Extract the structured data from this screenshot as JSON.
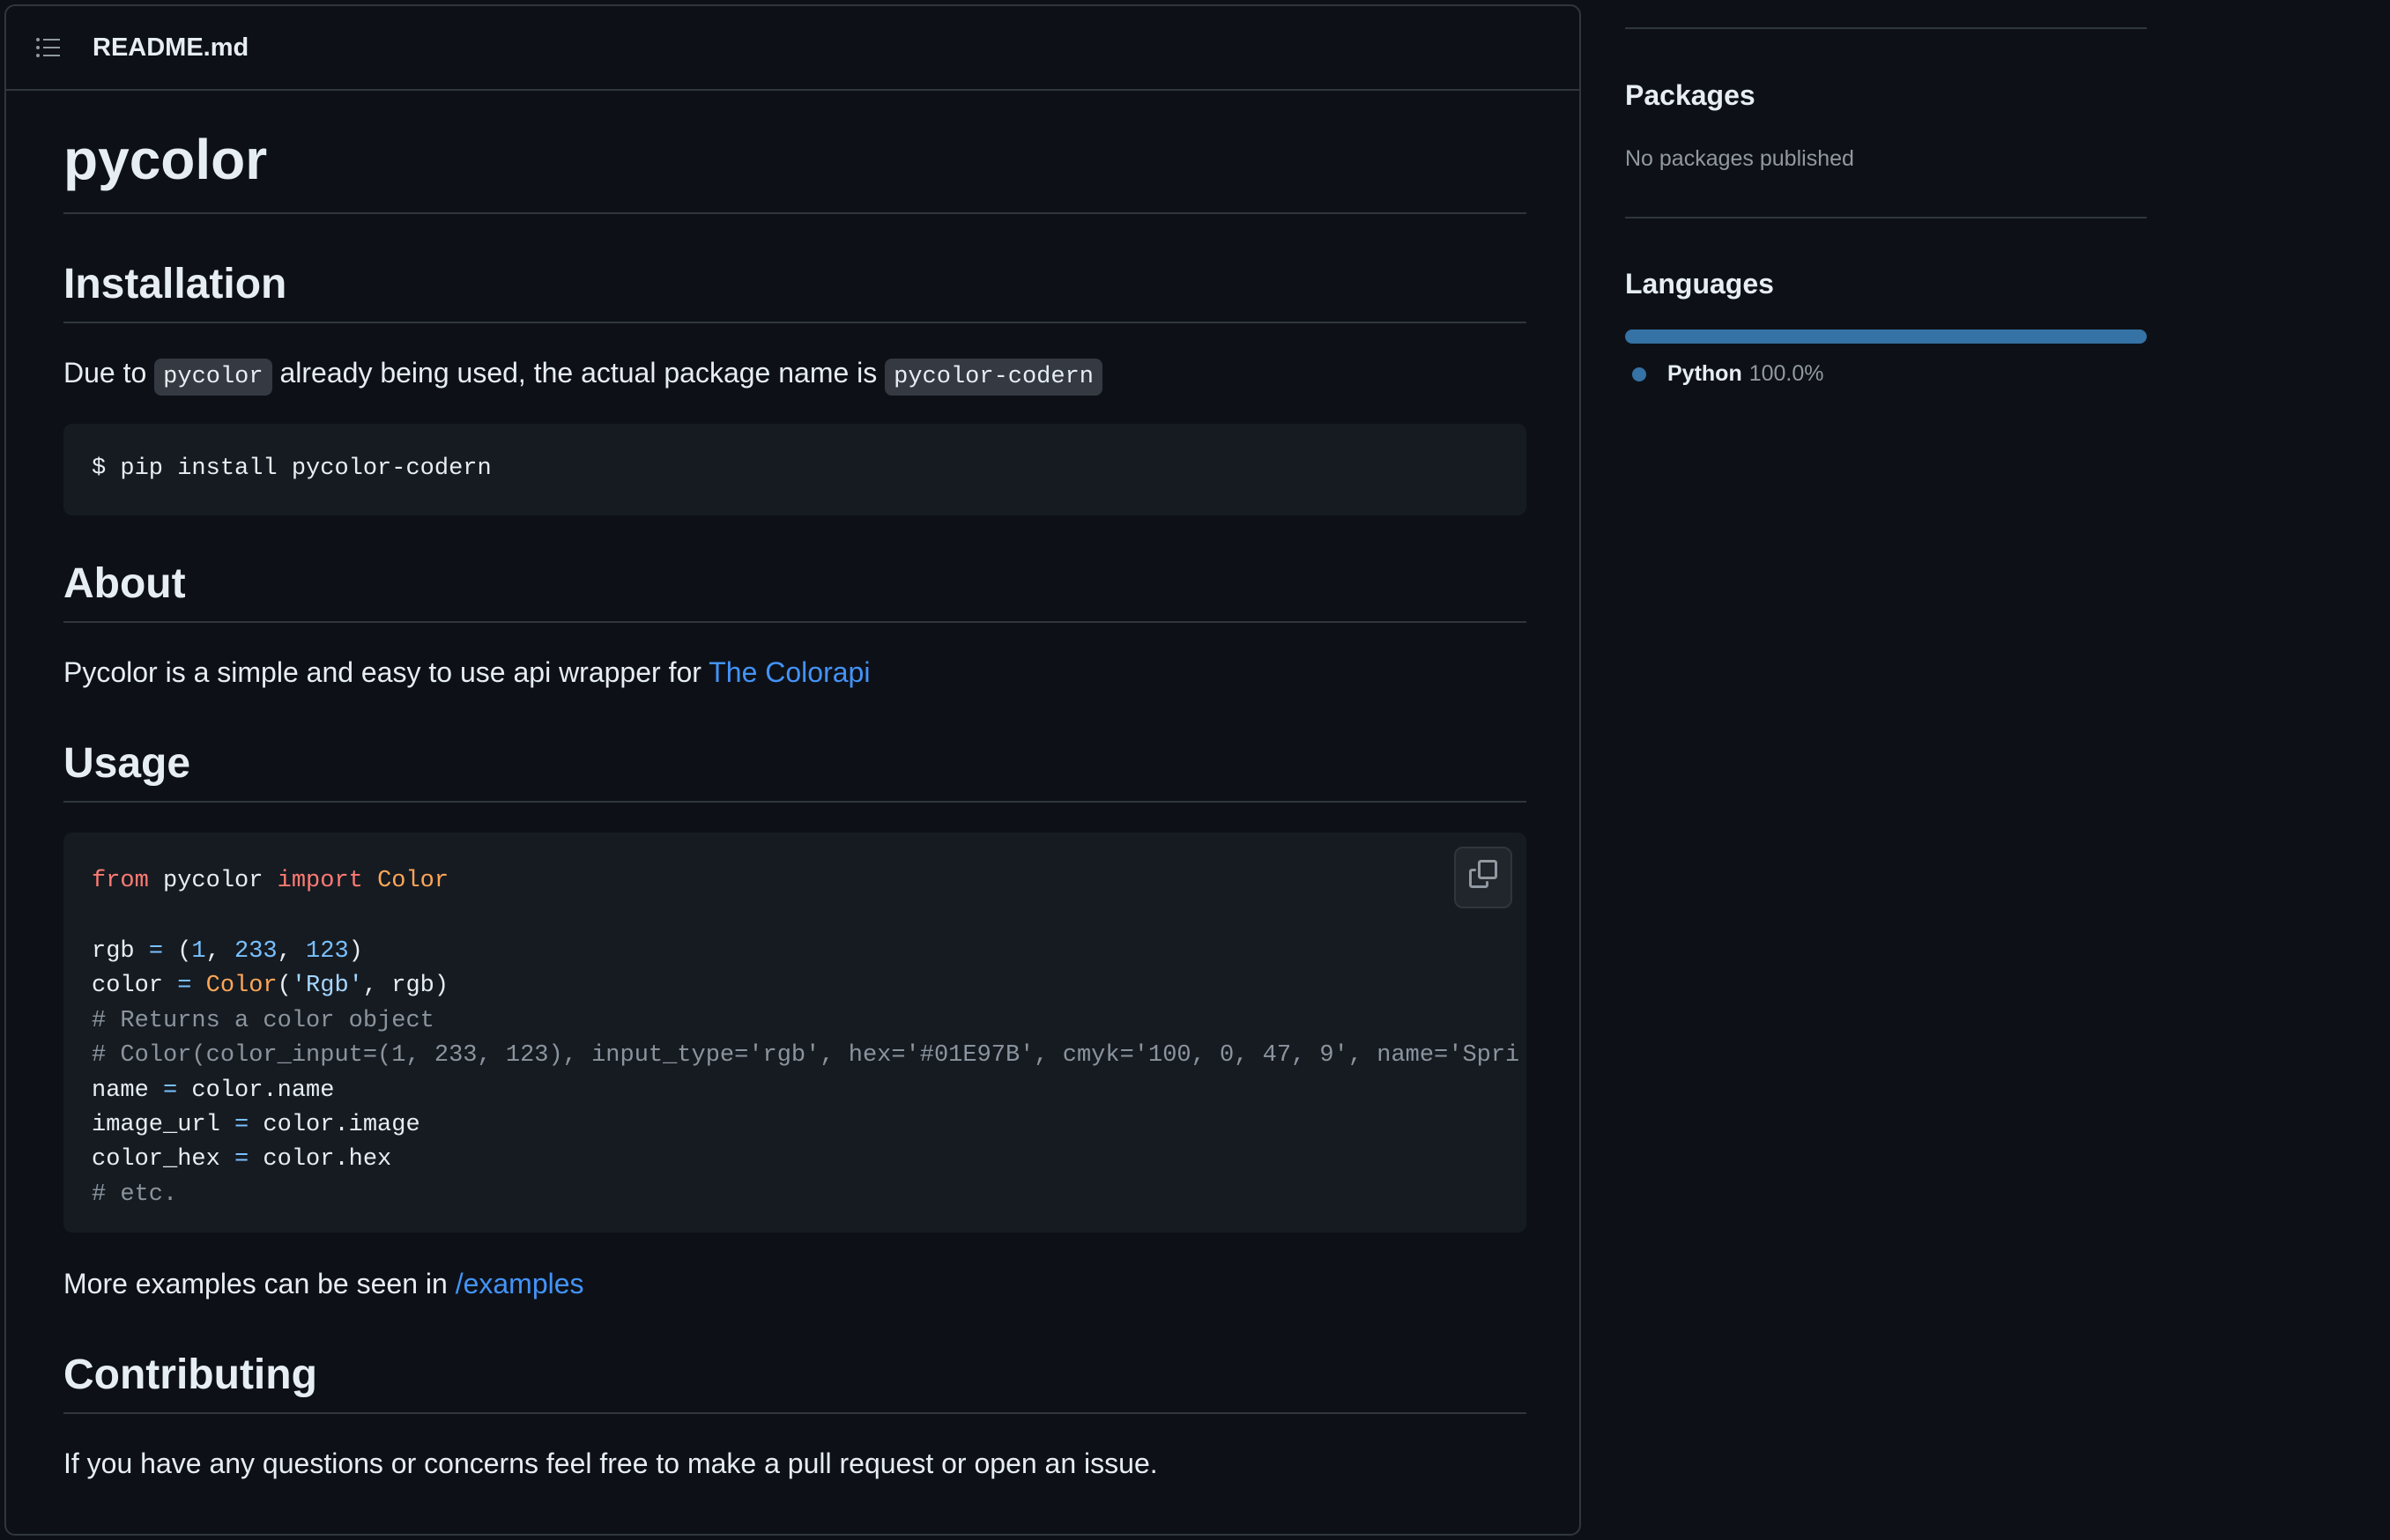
{
  "readme": {
    "filename": "README.md",
    "title": "pycolor",
    "installation": {
      "heading": "Installation",
      "text_before": "Due to ",
      "code1": "pycolor",
      "text_middle": " already being used, the actual package name is ",
      "code2": "pycolor-codern",
      "command": "$ pip install pycolor-codern"
    },
    "about": {
      "heading": "About",
      "text": "Pycolor is a simple and easy to use api wrapper for ",
      "link": "The Colorapi"
    },
    "usage": {
      "heading": "Usage",
      "code": {
        "l1_from": "from",
        "l1_mod": " pycolor ",
        "l1_import": "import",
        "l1_cls": "Color",
        "l3_a": "rgb ",
        "l3_eq": "=",
        "l3_b": " (",
        "l3_n1": "1",
        "l3_c1": ", ",
        "l3_n2": "233",
        "l3_c2": ", ",
        "l3_n3": "123",
        "l3_e": ")",
        "l4_a": "color ",
        "l4_eq": "=",
        "l4_sp": " ",
        "l4_cls": "Color",
        "l4_p": "(",
        "l4_str": "'Rgb'",
        "l4_rest": ", rgb)",
        "l5": "# Returns a color object",
        "l6": "# Color(color_input=(1, 233, 123), input_type='rgb', hex='#01E97B', cmyk='100, 0, 47, 9', name='Spri",
        "l7_a": "name ",
        "l7_eq": "=",
        "l7_b": " color.name",
        "l8_a": "image_url ",
        "l8_eq": "=",
        "l8_b": " color.image",
        "l9_a": "color_hex ",
        "l9_eq": "=",
        "l9_b": " color.hex",
        "l10": "# etc."
      },
      "more_text": "More examples can be seen in ",
      "more_link": "/examples"
    },
    "contributing": {
      "heading": "Contributing",
      "text": "If you have any questions or concerns feel free to make a pull request or open an issue."
    }
  },
  "sidebar": {
    "packages": {
      "heading": "Packages",
      "text": "No packages published"
    },
    "languages": {
      "heading": "Languages",
      "items": [
        {
          "name": "Python",
          "percent": "100.0%",
          "color": "#3572a5"
        }
      ]
    }
  },
  "colors": {
    "background": "#0d1117",
    "border": "#30363d",
    "link": "#4493f8",
    "keyword": "#ff7b72",
    "class": "#ffa657",
    "number": "#79c0ff",
    "comment": "#8b949e"
  }
}
